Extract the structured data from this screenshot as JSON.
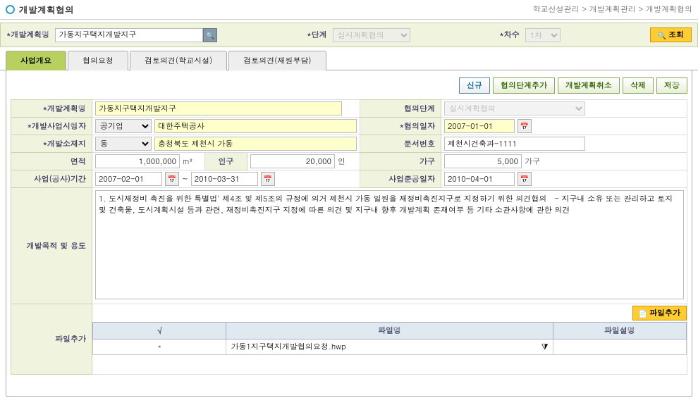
{
  "header": {
    "title": "개발계획협의",
    "breadcrumb": "학교신설관리 > 개발계획관리 > 개발계획협의"
  },
  "search": {
    "plan_label": "*개발계획명",
    "plan_value": "가동지구택지개발지구",
    "stage_label": "*단계",
    "stage_value": "실시계획협의",
    "order_label": "*차수",
    "order_value": "1차",
    "search_btn": "조회"
  },
  "tabs": {
    "t1": "사업개요",
    "t2": "협의요청",
    "t3": "검토의견(학교시설)",
    "t4": "검토의견(재원부담)"
  },
  "actions": {
    "new": "신규",
    "add_stage": "협의단계추가",
    "cancel": "개발계획취소",
    "delete": "삭제",
    "save": "저장"
  },
  "labels": {
    "plan_name": "*개발계획명",
    "stage": "협의단계",
    "dev_owner": "*개발사업시행자",
    "date": "*협의일자",
    "location": "*개발소재지",
    "doc_no": "문서번호",
    "area": "면적",
    "population": "인구",
    "household": "가구",
    "period": "사업(공사)기간",
    "completion": "사업준공일자",
    "purpose": "개발목적 및 용도",
    "file_add": "파일추가",
    "unit_m2": "m²",
    "unit_person": "인",
    "unit_house": "가구"
  },
  "values": {
    "plan_name": "가동지구택지개발지구",
    "stage": "실시계획협의",
    "owner_type": "공기업",
    "owner_name": "대한주택공사",
    "date": "2007-01-01",
    "loc_type": "동",
    "loc_detail": "충청북도 제천시 가동",
    "doc_no": "제천시건축과-1111",
    "area": "1,000,000",
    "population": "20,000",
    "household": "5,000",
    "period_start": "2007-02-01",
    "period_end": "2010-03-31",
    "completion": "2010-04-01",
    "purpose": "1. 도시재정비 촉진을 위한 특별법' 제4조 및 제5조의 규정에 의거 제천시 가동 일원을 재정비촉진지구로 지정하기 위한 의견협의   - 지구내 소유 또는 관리하고 토지 및 건축물, 도시계획시설 등과 관련, 재정비촉진지구 지정에 따른 의견 및 지구내 향후 개발계획 존재여부 등 기타 소관사항에 관한 의견"
  },
  "file": {
    "add_btn": "파일추가",
    "col_name": "파일명",
    "col_desc": "파일설명",
    "row1_name": "가동1지구택지개발협의요청.hwp",
    "row1_desc": ""
  }
}
